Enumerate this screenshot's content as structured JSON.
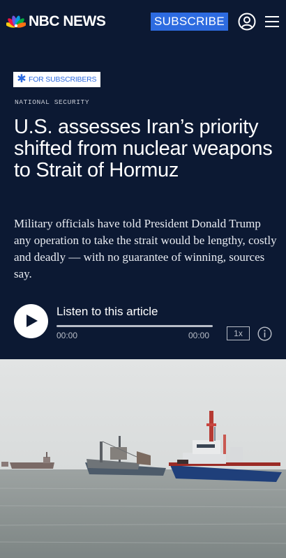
{
  "header": {
    "brand": "NBC NEWS",
    "subscribe_label": "SUBSCRIBE",
    "account_icon": "user-circle-icon",
    "menu_icon": "hamburger-menu-icon",
    "logo_icon": "peacock-logo-icon"
  },
  "article": {
    "badge_icon": "star-icon",
    "badge_label": "FOR SUBSCRIBERS",
    "section": "NATIONAL SECURITY",
    "headline": "U.S. assesses Iran’s priority shifted from nuclear weapons to Strait of Hormuz",
    "dek": "Military officials have told President Donald Trump any operation to take the strait would be lengthy, costly and deadly — with no guarantee of winning, sources say."
  },
  "audio_player": {
    "play_icon": "play-icon",
    "label": "Listen to this article",
    "progress": 0,
    "current_time": "00:00",
    "duration": "00:00",
    "speed": "1x",
    "info_icon": "info-icon"
  },
  "hero_image": {
    "subject": "ships-at-sea-photo"
  },
  "colors": {
    "page_background": "#0c1933",
    "subscribe_button": "#2d6be0",
    "badge_accent": "#2d6be0"
  }
}
